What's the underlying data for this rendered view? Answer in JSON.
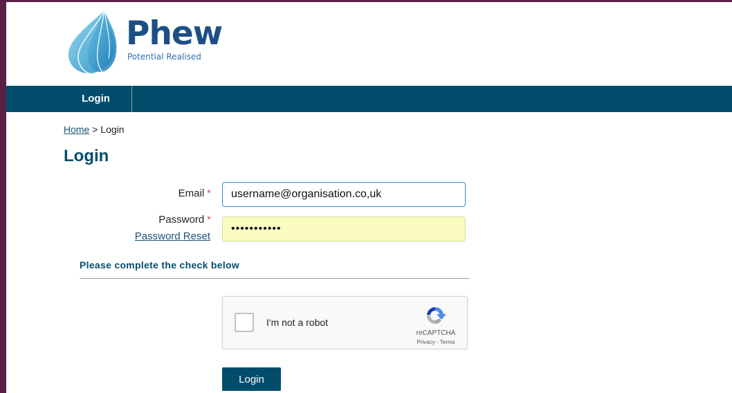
{
  "brand": {
    "name": "Phew",
    "tagline": "Potential Realised",
    "colors": {
      "navy": "#024d6c",
      "logo_blue": "#1c4f86",
      "frame": "#5a2148",
      "required": "#d9534f",
      "autofill": "#fbfcc0"
    }
  },
  "nav": {
    "items": [
      {
        "label": "Login"
      }
    ]
  },
  "breadcrumb": {
    "home": "Home",
    "separator": " > ",
    "current": "Login"
  },
  "page": {
    "title": "Login"
  },
  "form": {
    "email": {
      "label": "Email",
      "required_marker": "*",
      "value": "username@organisation.co,uk"
    },
    "password": {
      "label": "Password",
      "required_marker": "*",
      "masked_value": "•••••••••••",
      "reset_link": "Password Reset"
    },
    "check_heading": "Please complete the check below",
    "captcha": {
      "label": "I'm not a robot",
      "brand": "reCAPTCHA",
      "links": "Privacy - Terms",
      "checked": false
    },
    "submit_label": "Login"
  },
  "icons": {
    "logo": "water-drop-logo-icon",
    "captcha": "recaptcha-icon"
  }
}
